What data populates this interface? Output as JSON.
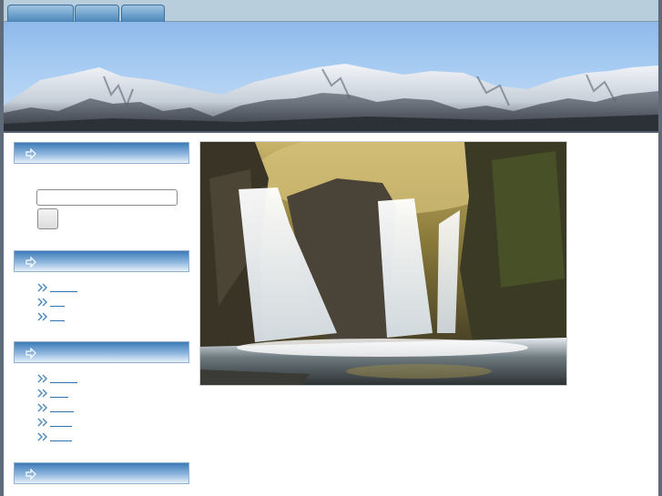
{
  "tabs": [
    {
      "label": ""
    },
    {
      "label": ""
    },
    {
      "label": ""
    }
  ],
  "sidebar": {
    "search": {
      "heading": "",
      "input_value": "",
      "placeholder": "",
      "button_label": ""
    },
    "menu1": {
      "heading": "",
      "items": [
        {
          "label": ""
        },
        {
          "label": ""
        },
        {
          "label": ""
        }
      ]
    },
    "menu2": {
      "heading": "",
      "items": [
        {
          "label": ""
        },
        {
          "label": ""
        },
        {
          "label": ""
        },
        {
          "label": ""
        },
        {
          "label": ""
        }
      ]
    },
    "menu3": {
      "heading": ""
    }
  },
  "colors": {
    "accent": "#4c86b8",
    "frame": "#5f6b78",
    "link": "#2f6fb0",
    "tabbar": "#b9cedc"
  },
  "icons": {
    "heading_arrow": "arrow-right-icon",
    "link_bullet": "double-chevron-icon"
  }
}
